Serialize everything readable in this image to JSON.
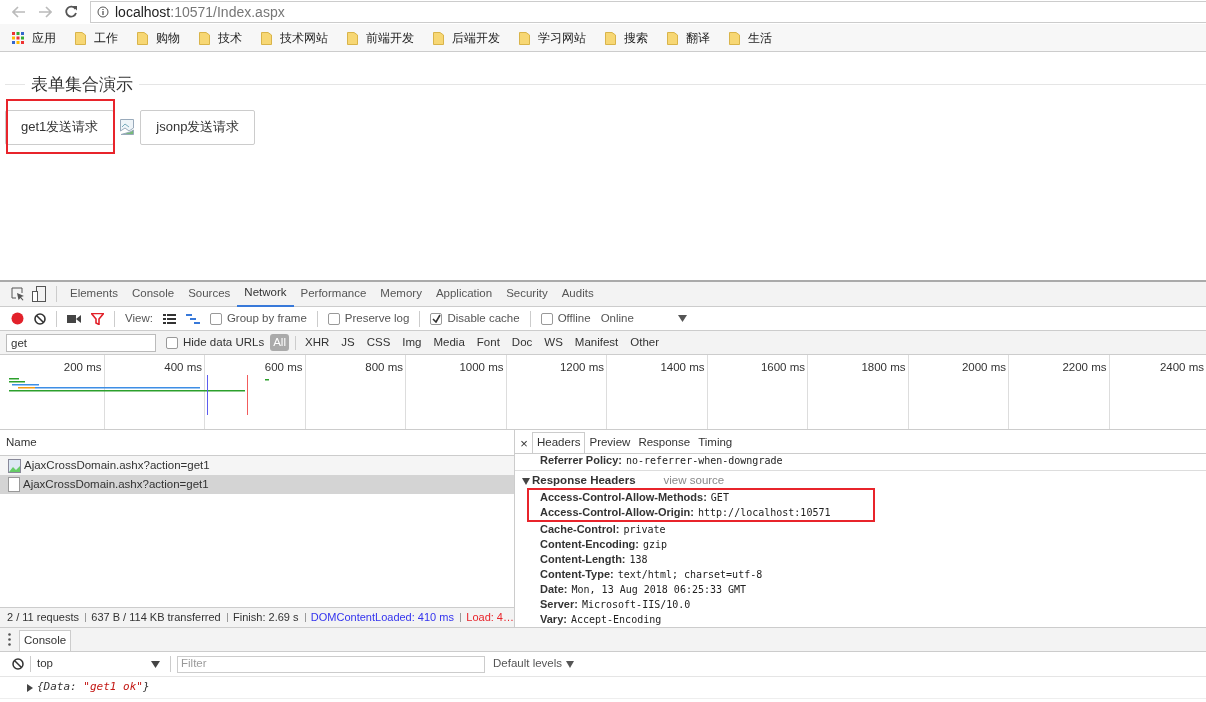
{
  "browser": {
    "address": {
      "host": "localhost",
      "rest": ":10571/Index.aspx"
    },
    "bookmarks": [
      {
        "label": "应用",
        "kind": "apps"
      },
      {
        "label": "工作",
        "kind": "folder"
      },
      {
        "label": "购物",
        "kind": "folder"
      },
      {
        "label": "技术",
        "kind": "folder"
      },
      {
        "label": "技术网站",
        "kind": "folder"
      },
      {
        "label": "前端开发",
        "kind": "folder"
      },
      {
        "label": "后端开发",
        "kind": "folder"
      },
      {
        "label": "学习网站",
        "kind": "folder"
      },
      {
        "label": "搜索",
        "kind": "folder"
      },
      {
        "label": "翻译",
        "kind": "folder"
      },
      {
        "label": "生活",
        "kind": "folder"
      }
    ]
  },
  "page": {
    "legend": "表单集合演示",
    "items": [
      {
        "kind": "button",
        "label": "get1发送请求",
        "highlighted": true
      },
      {
        "kind": "broken_image"
      },
      {
        "kind": "button",
        "label": "jsonp发送请求",
        "highlighted": false
      }
    ]
  },
  "devtools": {
    "tabs": [
      {
        "label": "Elements",
        "selected": false
      },
      {
        "label": "Console",
        "selected": false
      },
      {
        "label": "Sources",
        "selected": false
      },
      {
        "label": "Network",
        "selected": true
      },
      {
        "label": "Performance",
        "selected": false
      },
      {
        "label": "Memory",
        "selected": false
      },
      {
        "label": "Application",
        "selected": false
      },
      {
        "label": "Security",
        "selected": false
      },
      {
        "label": "Audits",
        "selected": false
      }
    ],
    "view_label": "View:",
    "options": [
      {
        "label": "Group by frame",
        "checked": false
      },
      {
        "label": "Preserve log",
        "checked": false
      },
      {
        "label": "Disable cache",
        "checked": true
      },
      {
        "label": "Offline",
        "checked": false
      }
    ],
    "throttle": "Online",
    "filter": {
      "value": "get"
    },
    "hide_data_urls": {
      "label": "Hide data URLs",
      "checked": false
    },
    "type_filters": [
      {
        "label": "All",
        "selected": true
      },
      {
        "label": "XHR",
        "selected": false
      },
      {
        "label": "JS",
        "selected": false
      },
      {
        "label": "CSS",
        "selected": false
      },
      {
        "label": "Img",
        "selected": false
      },
      {
        "label": "Media",
        "selected": false
      },
      {
        "label": "Font",
        "selected": false
      },
      {
        "label": "Doc",
        "selected": false
      },
      {
        "label": "WS",
        "selected": false
      },
      {
        "label": "Manifest",
        "selected": false
      },
      {
        "label": "Other",
        "selected": false
      }
    ],
    "ticks": [
      "200 ms",
      "400 ms",
      "600 ms",
      "800 ms",
      "1000 ms",
      "1200 ms",
      "1400 ms",
      "1600 ms",
      "1800 ms",
      "2000 ms",
      "2200 ms",
      "2400 ms"
    ],
    "requests": {
      "column": "Name",
      "rows": [
        {
          "name": "AjaxCrossDomain.ashx?action=get1",
          "kind": "image",
          "selected": false
        },
        {
          "name": "AjaxCrossDomain.ashx?action=get1",
          "kind": "document",
          "selected": true
        }
      ]
    },
    "summary": [
      {
        "text": "2 / 11 requests",
        "kind": "plain"
      },
      {
        "text": "637 B / 114 KB transferred",
        "kind": "plain"
      },
      {
        "text": "Finish: 2.69 s",
        "kind": "plain"
      },
      {
        "text": "DOMContentLoaded: 410 ms",
        "kind": "dom"
      },
      {
        "text": "Load: 4…",
        "kind": "load"
      }
    ],
    "close": "×",
    "detail_tabs": [
      {
        "label": "Headers",
        "selected": true
      },
      {
        "label": "Preview",
        "selected": false
      },
      {
        "label": "Response",
        "selected": false
      },
      {
        "label": "Timing",
        "selected": false
      }
    ],
    "request_headers_tail": [
      {
        "name": "Referrer Policy:",
        "value": "no-referrer-when-downgrade"
      }
    ],
    "response_section": {
      "title": "Response Headers",
      "expanded": true,
      "link": "view source"
    },
    "response_headers": [
      {
        "name": "Access-Control-Allow-Methods:",
        "value": "GET",
        "highlighted": true
      },
      {
        "name": "Access-Control-Allow-Origin:",
        "value": "http://localhost:10571",
        "highlighted": true
      },
      {
        "name": "Cache-Control:",
        "value": "private",
        "highlighted": false
      },
      {
        "name": "Content-Encoding:",
        "value": "gzip",
        "highlighted": false
      },
      {
        "name": "Content-Length:",
        "value": "138",
        "highlighted": false
      },
      {
        "name": "Content-Type:",
        "value": "text/html; charset=utf-8",
        "highlighted": false
      },
      {
        "name": "Date:",
        "value": "Mon, 13 Aug 2018 06:25:33 GMT",
        "highlighted": false
      },
      {
        "name": "Server:",
        "value": "Microsoft-IIS/10.0",
        "highlighted": false
      },
      {
        "name": "Vary:",
        "value": "Accept-Encoding",
        "highlighted": false
      }
    ],
    "drawer": {
      "tab": "Console",
      "context": "top",
      "filter_placeholder": "Filter",
      "levels": "Default levels",
      "output": {
        "before": "{Data: ",
        "value": "\"get1 ok\"",
        "after": "}"
      }
    }
  }
}
